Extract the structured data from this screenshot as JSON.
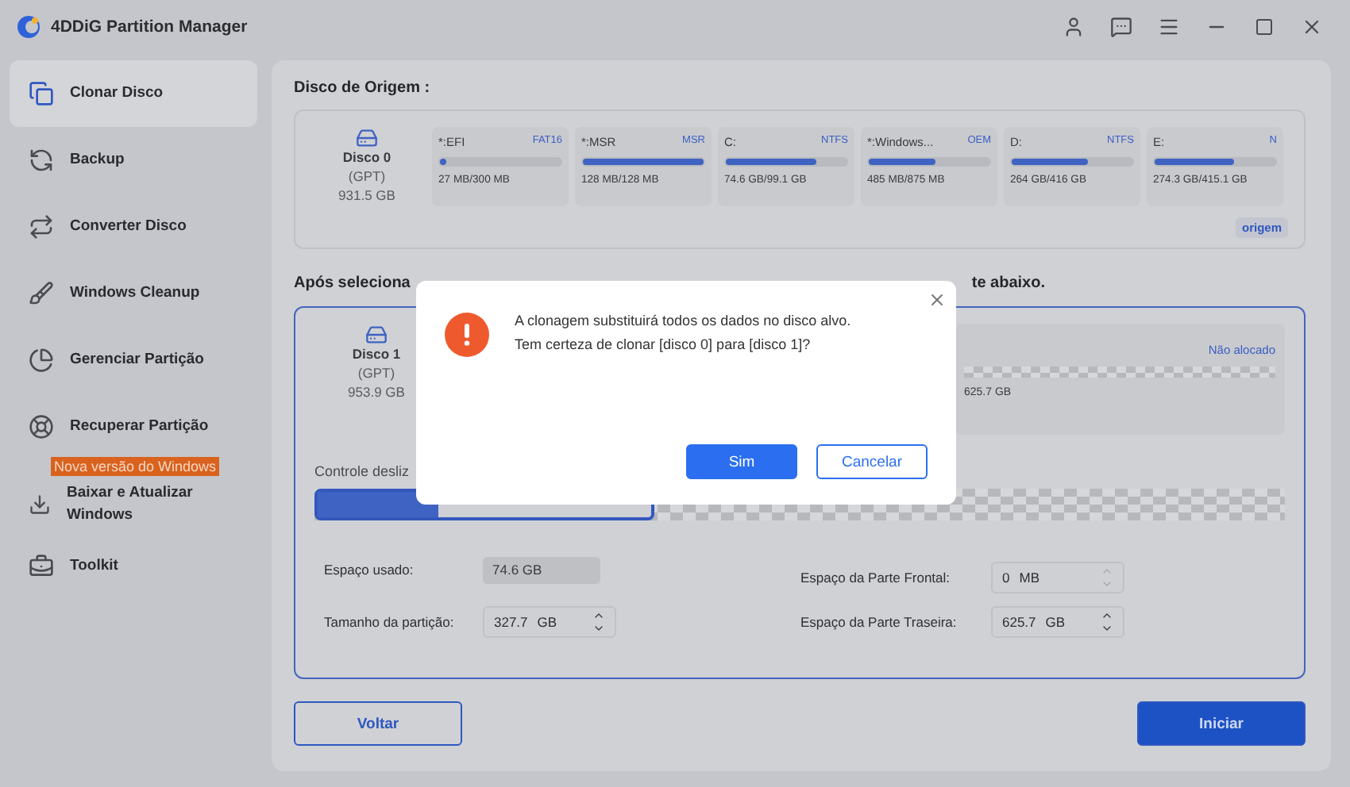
{
  "window": {
    "title": "4DDiG Partition Manager"
  },
  "sidebar": {
    "items": [
      {
        "label": "Clonar Disco",
        "selected": true
      },
      {
        "label": "Backup",
        "selected": false
      },
      {
        "label": "Converter Disco",
        "selected": false
      },
      {
        "label": "Windows Cleanup",
        "selected": false
      },
      {
        "label": "Gerenciar Partição",
        "selected": false
      },
      {
        "label": "Recuperar Partição",
        "selected": false
      },
      {
        "label": "Baixar e Atualizar Windows",
        "selected": false,
        "badge": "Nova versão do Windows"
      },
      {
        "label": "Toolkit",
        "selected": false
      }
    ]
  },
  "source": {
    "title": "Disco de Origem :",
    "disk": {
      "name": "Disco 0",
      "style": "(GPT)",
      "size": "931.5 GB"
    },
    "partitions": [
      {
        "name": "*:EFI",
        "fs": "FAT16",
        "level": 0.05,
        "usage": "27 MB/300 MB"
      },
      {
        "name": "*:MSR",
        "fs": "MSR",
        "level": 1,
        "usage": "128 MB/128 MB"
      },
      {
        "name": "C:",
        "fs": "NTFS",
        "level": 0.75,
        "usage": "74.6 GB/99.1 GB"
      },
      {
        "name": "*:Windows...",
        "fs": "OEM",
        "level": 0.55,
        "usage": "485 MB/875 MB"
      },
      {
        "name": "D:",
        "fs": "NTFS",
        "level": 0.63,
        "usage": "264 GB/416 GB"
      },
      {
        "name": "E:",
        "fs": "N",
        "level": 0.66,
        "usage": "274.3 GB/415.1 GB"
      }
    ],
    "badge": "origem"
  },
  "target": {
    "title_left": "Após seleciona",
    "title_right": "te abaixo.",
    "disk": {
      "name": "Disco 1",
      "style": "(GPT)",
      "size": "953.9 GB"
    },
    "unallocated": {
      "label": "Não alocado",
      "size": "625.7 GB"
    },
    "slider": {
      "label": "Controle desliz",
      "level": 0.35
    },
    "fields": [
      {
        "label": "Espaço usado:",
        "value": "74.6 GB",
        "kind": "readonly"
      },
      {
        "label": "Espaço da Parte Frontal:",
        "value": "0",
        "unit": "MB",
        "kind": "spinner",
        "disabled": true
      },
      {
        "label": "Tamanho da partição:",
        "value": "327.7",
        "unit": "GB",
        "kind": "spinner",
        "disabled": false
      },
      {
        "label": "Espaço da Parte Traseira:",
        "value": "625.7",
        "unit": "GB",
        "kind": "spinner",
        "disabled": false
      }
    ]
  },
  "buttons": {
    "back": "Voltar",
    "start": "Iniciar"
  },
  "dialog": {
    "message": "A clonagem substituirá todos os dados no disco alvo.\nTem certeza de clonar [disco 0] para [disco 1]?",
    "confirm": "Sim",
    "cancel": "Cancelar"
  }
}
